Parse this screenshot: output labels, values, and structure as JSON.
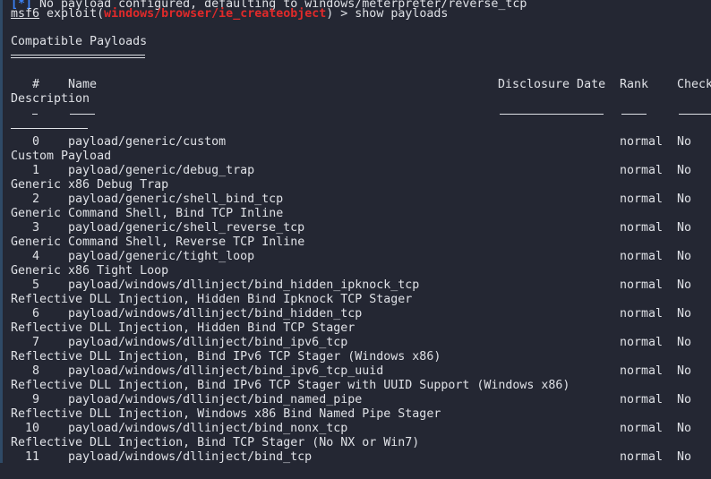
{
  "terminal": {
    "info_line": {
      "marker": "[*]",
      "text": " No payload configured, defaulting to windows/meterpreter/reverse_tcp"
    },
    "prompt": {
      "name": "msf6",
      "context_prefix": " exploit(",
      "module": "windows/browser/ie_createobject",
      "context_suffix": ") > ",
      "command": "show payloads"
    },
    "section_title": "Compatible Payloads",
    "headers": {
      "num": "#",
      "name": "Name",
      "disclosure_date": "Disclosure Date",
      "rank": "Rank",
      "check": "Check",
      "description": "Description"
    },
    "rows": [
      {
        "num": "0",
        "name": "payload/generic/custom",
        "rank": "normal",
        "check": "No",
        "description": "Custom Payload"
      },
      {
        "num": "1",
        "name": "payload/generic/debug_trap",
        "rank": "normal",
        "check": "No",
        "description": "Generic x86 Debug Trap"
      },
      {
        "num": "2",
        "name": "payload/generic/shell_bind_tcp",
        "rank": "normal",
        "check": "No",
        "description": "Generic Command Shell, Bind TCP Inline"
      },
      {
        "num": "3",
        "name": "payload/generic/shell_reverse_tcp",
        "rank": "normal",
        "check": "No",
        "description": "Generic Command Shell, Reverse TCP Inline"
      },
      {
        "num": "4",
        "name": "payload/generic/tight_loop",
        "rank": "normal",
        "check": "No",
        "description": "Generic x86 Tight Loop"
      },
      {
        "num": "5",
        "name": "payload/windows/dllinject/bind_hidden_ipknock_tcp",
        "rank": "normal",
        "check": "No",
        "description": "Reflective DLL Injection, Hidden Bind Ipknock TCP Stager"
      },
      {
        "num": "6",
        "name": "payload/windows/dllinject/bind_hidden_tcp",
        "rank": "normal",
        "check": "No",
        "description": "Reflective DLL Injection, Hidden Bind TCP Stager"
      },
      {
        "num": "7",
        "name": "payload/windows/dllinject/bind_ipv6_tcp",
        "rank": "normal",
        "check": "No",
        "description": "Reflective DLL Injection, Bind IPv6 TCP Stager (Windows x86)"
      },
      {
        "num": "8",
        "name": "payload/windows/dllinject/bind_ipv6_tcp_uuid",
        "rank": "normal",
        "check": "No",
        "description": "Reflective DLL Injection, Bind IPv6 TCP Stager with UUID Support (Windows x86)"
      },
      {
        "num": "9",
        "name": "payload/windows/dllinject/bind_named_pipe",
        "rank": "normal",
        "check": "No",
        "description": "Reflective DLL Injection, Windows x86 Bind Named Pipe Stager"
      },
      {
        "num": "10",
        "name": "payload/windows/dllinject/bind_nonx_tcp",
        "rank": "normal",
        "check": "No",
        "description": "Reflective DLL Injection, Bind TCP Stager (No NX or Win7)"
      },
      {
        "num": "11",
        "name": "payload/windows/dllinject/bind_tcp",
        "rank": "normal",
        "check": "No",
        "description": ""
      }
    ],
    "colors": {
      "background": "#242733",
      "text": "#dfe1e6",
      "module": "#e02a2a",
      "marker": "#3b82f6"
    }
  }
}
